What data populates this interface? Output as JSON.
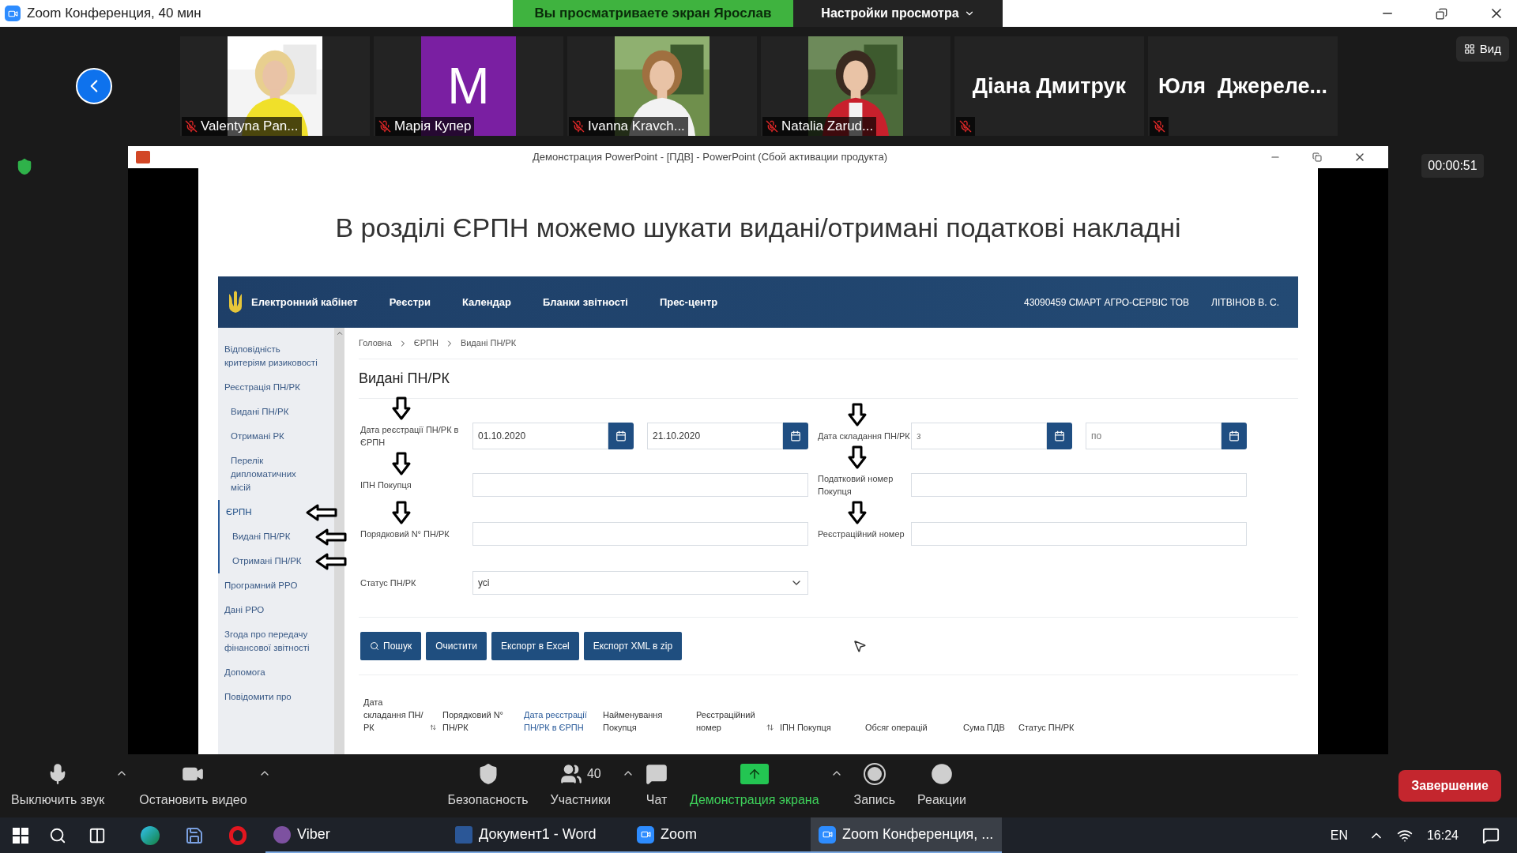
{
  "window": {
    "title": "Zoom Конференция, 40 мин"
  },
  "share_banner": {
    "text": "Вы просматриваете экран Ярослав",
    "view_settings": "Настройки просмотра"
  },
  "gallery": {
    "view_button": "Вид",
    "participants": [
      {
        "name": "Valentyna Pan...",
        "kind": "video",
        "muted": true
      },
      {
        "name": "Марія Купер",
        "kind": "avatar",
        "initial": "M",
        "color": "#7a1fa2",
        "muted": true
      },
      {
        "name": "Ivanna Kravch...",
        "kind": "video",
        "muted": true
      },
      {
        "name": "Natalia Zarud...",
        "kind": "video",
        "muted": true
      },
      {
        "name": "Діана Дмитрук",
        "kind": "name_only",
        "muted": true
      },
      {
        "name": "Юля  Джереле...",
        "kind": "name_only",
        "muted": true
      }
    ]
  },
  "timer": "00:00:51",
  "shared_window": {
    "title": "Демонстрация PowerPoint - [ПДВ] - PowerPoint (Сбой активации продукта)",
    "slide": {
      "title": "В розділі ЄРПН можемо шукати видані/отримані податкові накладні",
      "portal": {
        "brand": "Електронний кабінет",
        "nav": [
          "Реєстри",
          "Календар",
          "Бланки звітності",
          "Прес-центр"
        ],
        "company": "43090459 СМАРТ АГРО-СЕРВІС ТОВ",
        "user": "ЛІТВІНОВ В. С.",
        "sidebar": [
          {
            "label": "Відповідність критеріям ризиковості",
            "selected": false,
            "arrow": false
          },
          {
            "label": "Реєстрація ПН/РК",
            "selected": false,
            "arrow": false,
            "children": [
              {
                "label": "Видані ПН/РК",
                "arrow": false
              },
              {
                "label": "Отримані РК",
                "arrow": false
              },
              {
                "label": "Перелік дипломатичних місій",
                "arrow": false
              }
            ]
          },
          {
            "label": "ЄРПН",
            "selected": true,
            "arrow": true,
            "children": [
              {
                "label": "Видані ПН/РК",
                "arrow": true
              },
              {
                "label": "Отримані ПН/РК",
                "arrow": true
              }
            ]
          },
          {
            "label": "Програмний РРО",
            "selected": false,
            "arrow": false
          },
          {
            "label": "Дані РРО",
            "selected": false,
            "arrow": false
          },
          {
            "label": "Згода про передачу фінансової звітності",
            "selected": false,
            "arrow": false
          },
          {
            "label": "Допомога",
            "selected": false,
            "arrow": false
          },
          {
            "label": "Повідомити про",
            "selected": false,
            "arrow": false
          }
        ],
        "breadcrumb": [
          "Головна",
          "ЄРПН",
          "Видані ПН/РК"
        ],
        "heading": "Видані ПН/РК",
        "form_rows": [
          {
            "left": {
              "label": "Дата реєстрації ПН/РК в ЄРПН",
              "arrow": true,
              "kind": "date_range",
              "fields": [
                {
                  "value": "01.10.2020"
                },
                {
                  "value": "21.10.2020"
                }
              ]
            },
            "right": {
              "label": "Дата складання ПН/РК",
              "arrow": true,
              "kind": "date_range",
              "fields": [
                {
                  "placeholder": "з"
                },
                {
                  "placeholder": "по"
                }
              ]
            }
          },
          {
            "left": {
              "label": "ІПН Покупця",
              "arrow": true,
              "kind": "text"
            },
            "right": {
              "label": "Податковий номер Покупця",
              "arrow": true,
              "kind": "text"
            }
          },
          {
            "left": {
              "label": "Порядковий N° ПН/РК",
              "arrow": true,
              "kind": "text"
            },
            "right": {
              "label": "Реєстраційний номер",
              "arrow": true,
              "kind": "text"
            }
          },
          {
            "left": {
              "label": "Статус ПН/РК",
              "arrow": false,
              "kind": "select",
              "value": "усі"
            }
          }
        ],
        "buttons": [
          {
            "label": "Пошук",
            "kind": "search"
          },
          {
            "label": "Очистити",
            "kind": "plain"
          },
          {
            "label": "Експорт в Excel",
            "kind": "plain"
          },
          {
            "label": "Експорт XML в zip",
            "kind": "plain"
          }
        ],
        "table": {
          "columns": [
            {
              "label": "Дата складання ПН/РК",
              "sortable": true,
              "active": false
            },
            {
              "label": "Порядковий N° ПН/РК",
              "sortable": false,
              "active": false
            },
            {
              "label": "Дата реєстрації ПН/РК в ЄРПН",
              "sortable": false,
              "active": true
            },
            {
              "label": "Найменування Покупця",
              "sortable": false,
              "active": false
            },
            {
              "label": "Реєстраційний номер",
              "sortable": true,
              "active": false
            },
            {
              "label": "ІПН Покупця",
              "sortable": false,
              "active": false
            },
            {
              "label": "Обсяг операцій",
              "sortable": false,
              "active": false
            },
            {
              "label": "Сума ПДВ",
              "sortable": false,
              "active": false
            },
            {
              "label": "Статус ПН/РК",
              "sortable": false,
              "active": false
            }
          ]
        }
      }
    }
  },
  "toolbar": {
    "items": [
      {
        "label": "Выключить звук",
        "caret": true,
        "active": false
      },
      {
        "label": "Остановить видео",
        "caret": true,
        "active": false
      },
      {
        "label": "Безопасность",
        "caret": false,
        "active": false
      },
      {
        "label": "Участники",
        "count": "40",
        "caret": true,
        "active": false
      },
      {
        "label": "Чат",
        "caret": false,
        "active": false
      },
      {
        "label": "Демонстрация экрана",
        "caret": true,
        "active": true
      },
      {
        "label": "Запись",
        "caret": false,
        "active": false
      },
      {
        "label": "Реакции",
        "caret": false,
        "active": false
      }
    ],
    "end_button": "Завершение"
  },
  "taskbar": {
    "apps": [
      {
        "label": "Viber",
        "selected": false
      },
      {
        "label": "Документ1 - Word",
        "selected": false
      },
      {
        "label": "Zoom",
        "selected": false
      },
      {
        "label": "Zoom Конференция, ...",
        "selected": true
      }
    ],
    "language": "EN",
    "time": "16:24"
  }
}
